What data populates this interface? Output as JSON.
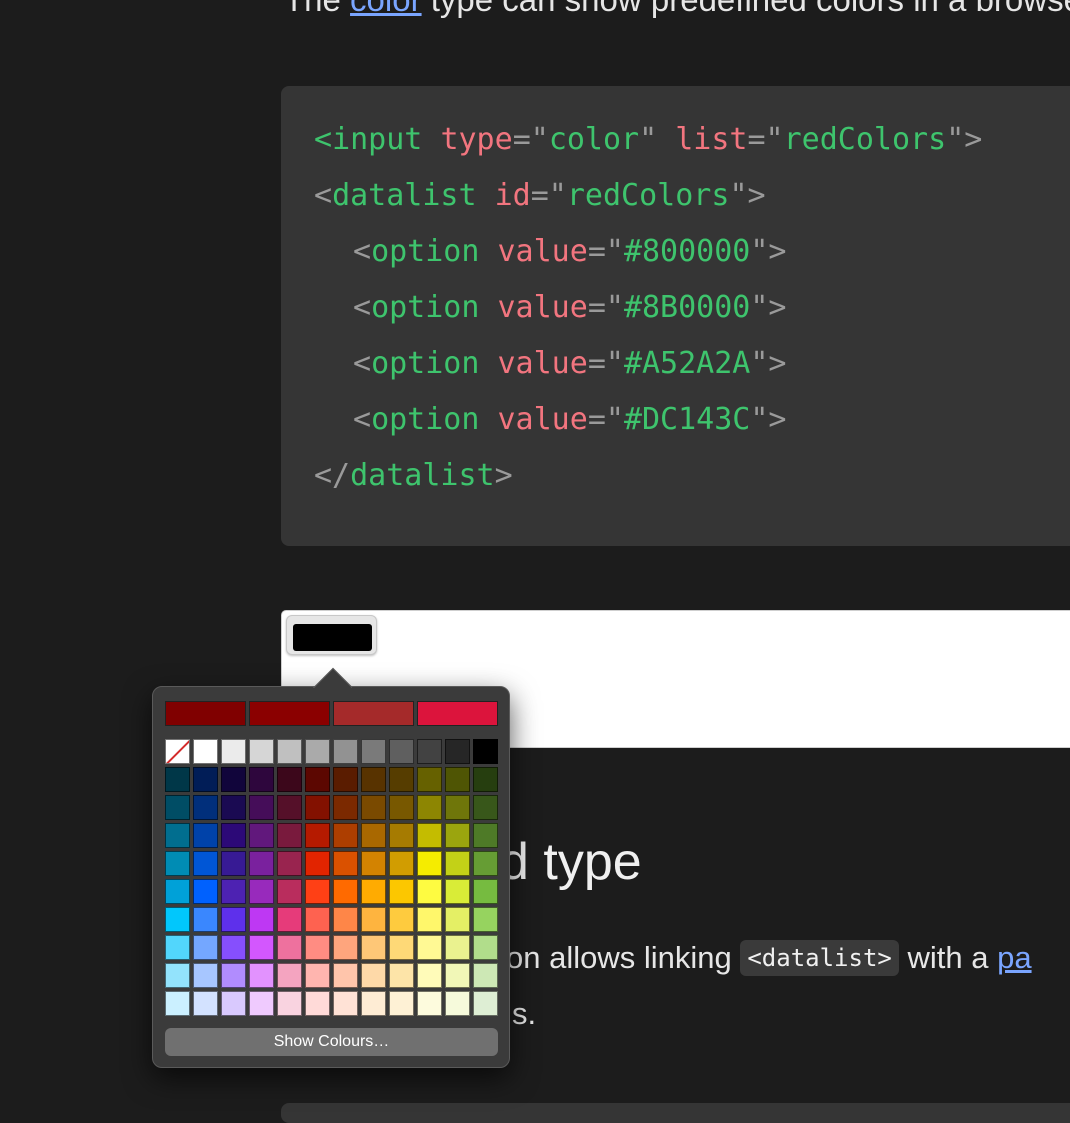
{
  "intro": {
    "before": "The ",
    "link": "color",
    "after": " type can show predefined colors in a browser"
  },
  "code": {
    "lines": [
      {
        "indent": false,
        "parts": [
          {
            "t": "tag",
            "v": "<"
          },
          {
            "t": "tag",
            "v": "input"
          },
          {
            "t": "plain",
            "v": " "
          },
          {
            "t": "attr",
            "v": "type"
          },
          {
            "t": "punct",
            "v": "=\""
          },
          {
            "t": "str",
            "v": "color"
          },
          {
            "t": "punct",
            "v": "\""
          },
          {
            "t": "plain",
            "v": " "
          },
          {
            "t": "attr",
            "v": "list"
          },
          {
            "t": "punct",
            "v": "=\""
          },
          {
            "t": "str",
            "v": "redColors"
          },
          {
            "t": "punct",
            "v": "\">"
          }
        ]
      },
      {
        "indent": false,
        "parts": [
          {
            "t": "punct",
            "v": "<"
          },
          {
            "t": "tag",
            "v": "datalist"
          },
          {
            "t": "plain",
            "v": " "
          },
          {
            "t": "attr",
            "v": "id"
          },
          {
            "t": "punct",
            "v": "=\""
          },
          {
            "t": "str",
            "v": "redColors"
          },
          {
            "t": "punct",
            "v": "\">"
          }
        ]
      },
      {
        "indent": true,
        "parts": [
          {
            "t": "punct",
            "v": "<"
          },
          {
            "t": "tag",
            "v": "option"
          },
          {
            "t": "plain",
            "v": " "
          },
          {
            "t": "attr",
            "v": "value"
          },
          {
            "t": "punct",
            "v": "=\""
          },
          {
            "t": "str",
            "v": "#800000"
          },
          {
            "t": "punct",
            "v": "\">"
          }
        ]
      },
      {
        "indent": true,
        "parts": [
          {
            "t": "punct",
            "v": "<"
          },
          {
            "t": "tag",
            "v": "option"
          },
          {
            "t": "plain",
            "v": " "
          },
          {
            "t": "attr",
            "v": "value"
          },
          {
            "t": "punct",
            "v": "=\""
          },
          {
            "t": "str",
            "v": "#8B0000"
          },
          {
            "t": "punct",
            "v": "\">"
          }
        ]
      },
      {
        "indent": true,
        "parts": [
          {
            "t": "punct",
            "v": "<"
          },
          {
            "t": "tag",
            "v": "option"
          },
          {
            "t": "plain",
            "v": " "
          },
          {
            "t": "attr",
            "v": "value"
          },
          {
            "t": "punct",
            "v": "=\""
          },
          {
            "t": "str",
            "v": "#A52A2A"
          },
          {
            "t": "punct",
            "v": "\">"
          }
        ]
      },
      {
        "indent": true,
        "parts": [
          {
            "t": "punct",
            "v": "<"
          },
          {
            "t": "tag",
            "v": "option"
          },
          {
            "t": "plain",
            "v": " "
          },
          {
            "t": "attr",
            "v": "value"
          },
          {
            "t": "punct",
            "v": "=\""
          },
          {
            "t": "str",
            "v": "#DC143C"
          },
          {
            "t": "punct",
            "v": "\">"
          }
        ]
      },
      {
        "indent": false,
        "parts": [
          {
            "t": "punct",
            "v": "</"
          },
          {
            "t": "tag",
            "v": "datalist"
          },
          {
            "t": "punct",
            "v": ">"
          }
        ]
      }
    ]
  },
  "color_input": {
    "current_value": "#000000"
  },
  "heading": "d type",
  "paragraph": {
    "before": "on allows linking ",
    "code": "<datalist>",
    "after": " with a ",
    "link": "pa",
    "line2": "s."
  },
  "picker": {
    "suggested_colors": [
      "#800000",
      "#8B0000",
      "#A52A2A",
      "#DC143C"
    ],
    "grayscale_row": [
      "#FFFFFF",
      "#EBEBEB",
      "#D6D6D6",
      "#C0C0C0",
      "#AAAAAA",
      "#929292",
      "#7A7A7A",
      "#5F5F5F",
      "#424242",
      "#262626",
      "#000000"
    ],
    "color_rows": [
      [
        "#003748",
        "#011D57",
        "#11053B",
        "#2E063D",
        "#3C071B",
        "#5C0701",
        "#5A1C00",
        "#583300",
        "#563D00",
        "#666100",
        "#4F5504",
        "#263E0F"
      ],
      [
        "#004D65",
        "#012F7B",
        "#1A0A52",
        "#450D59",
        "#551029",
        "#831100",
        "#7B2900",
        "#7A4A00",
        "#785800",
        "#8D8602",
        "#6F760A",
        "#38571A"
      ],
      [
        "#016E8F",
        "#0042A9",
        "#2C0977",
        "#61187C",
        "#791A3D",
        "#B51A00",
        "#AD3E00",
        "#A96800",
        "#A67B01",
        "#C4BC00",
        "#9BA50E",
        "#4E7A27"
      ],
      [
        "#008CB4",
        "#0056D6",
        "#371A94",
        "#7A219E",
        "#99244F",
        "#E22400",
        "#DA5100",
        "#D38301",
        "#D19D01",
        "#F5EC00",
        "#C3D117",
        "#669D34"
      ],
      [
        "#00A1D8",
        "#0061FE",
        "#4D22B2",
        "#982ABC",
        "#B92D5D",
        "#FF4015",
        "#FF6A00",
        "#FFAB01",
        "#FCC700",
        "#FEFB41",
        "#D9EC37",
        "#76BB40"
      ],
      [
        "#01C7FC",
        "#3A87FE",
        "#5E30EB",
        "#BE38F3",
        "#E63B7A",
        "#FE6250",
        "#FE8648",
        "#FEB43F",
        "#FECB3E",
        "#FFF76B",
        "#E4EF65",
        "#96D35F"
      ],
      [
        "#52D6FC",
        "#74A7FF",
        "#864FFD",
        "#D357FE",
        "#EE719E",
        "#FF8C82",
        "#FEA57D",
        "#FEC777",
        "#FED977",
        "#FFF994",
        "#EAF28F",
        "#B1DD8B"
      ],
      [
        "#93E3FC",
        "#A7C6FF",
        "#B18CFE",
        "#E292FE",
        "#F4A4C0",
        "#FFB5AF",
        "#FFC5AB",
        "#FED9A8",
        "#FDE4A8",
        "#FFFBB9",
        "#F1F7B7",
        "#CDE8B5"
      ],
      [
        "#CBF0FF",
        "#D3E2FF",
        "#D9C9FE",
        "#EFCAFE",
        "#F9D3E0",
        "#FFDAD8",
        "#FFE2D6",
        "#FEECD4",
        "#FEF1D5",
        "#FDFBDD",
        "#F6FADB",
        "#DEEED4"
      ]
    ],
    "show_colours_label": "Show Colours…"
  }
}
